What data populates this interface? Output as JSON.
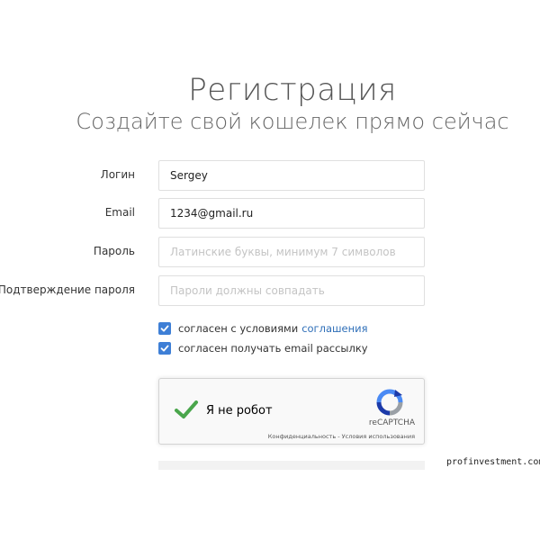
{
  "header": {
    "title": "Регистрация",
    "subtitle": "Создайте свой кошелек прямо сейчас"
  },
  "form": {
    "login": {
      "label": "Логин",
      "value": "Sergey",
      "placeholder": ""
    },
    "email": {
      "label": "Email",
      "value": "1234@gmail.ru",
      "placeholder": ""
    },
    "password": {
      "label": "Пароль",
      "value": "",
      "placeholder": "Латинские буквы, минимум 7 символов"
    },
    "password_confirm": {
      "label": "Подтверждение пароля",
      "value": "",
      "placeholder": "Пароли должны совпадать"
    }
  },
  "checkboxes": {
    "terms": {
      "text": "согласен с условиями",
      "link": "соглашения",
      "checked": true
    },
    "newsletter": {
      "text": "согласен получать email рассылку",
      "checked": true
    }
  },
  "recaptcha": {
    "label": "Я не робот",
    "brand": "reCAPTCHA",
    "privacy": "Конфиденциальность",
    "separator": " - ",
    "terms": "Условия использования"
  },
  "watermark": "profinvestment.com",
  "colors": {
    "accent": "#3e7fd6",
    "link": "#2f6fb8",
    "recaptcha_check": "#4aa64c"
  }
}
